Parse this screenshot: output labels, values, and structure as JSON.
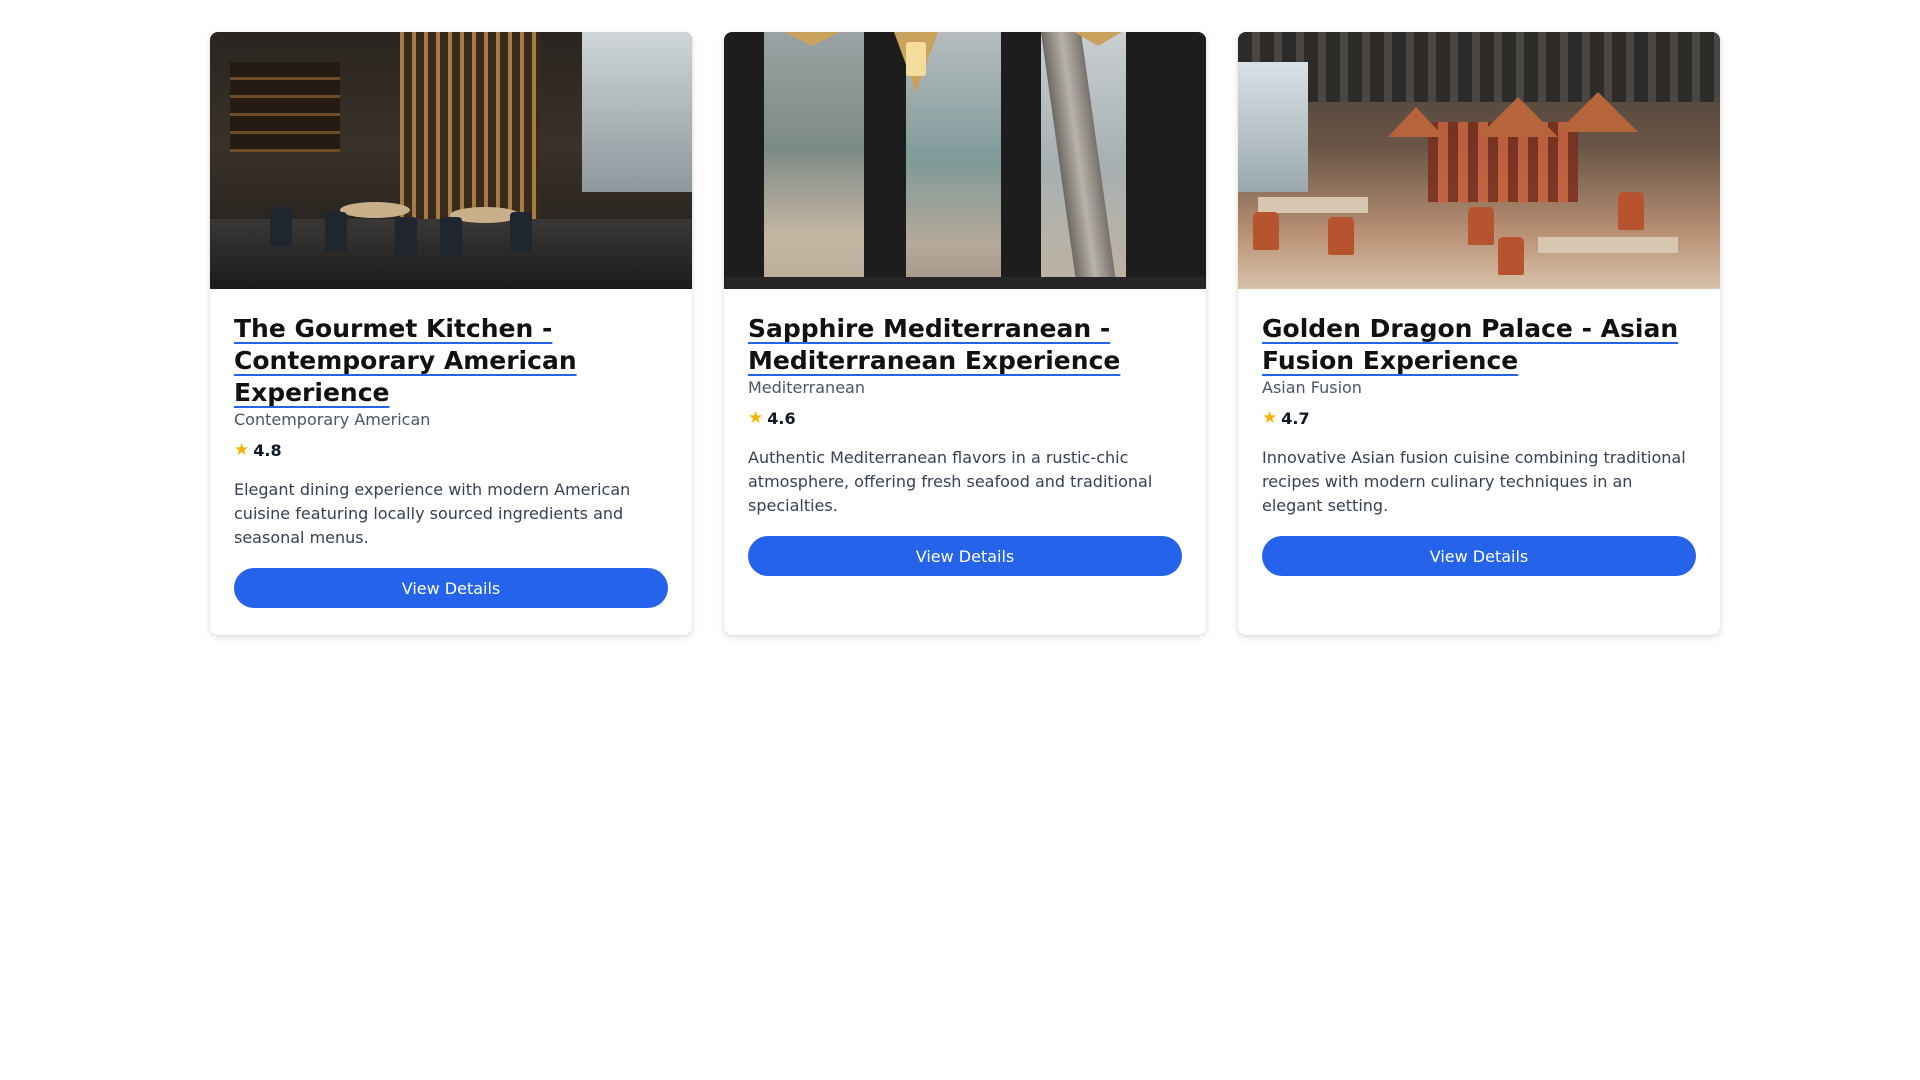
{
  "restaurants": [
    {
      "title": "The Gourmet Kitchen - Contemporary American Experience",
      "cuisine": "Contemporary American",
      "rating": "4.8",
      "description": "Elegant dining experience with modern American cuisine featuring locally sourced ingredients and seasonal menus.",
      "button": "View Details"
    },
    {
      "title": "Sapphire Mediterranean - Mediterranean Experience",
      "cuisine": "Mediterranean",
      "rating": "4.6",
      "description": "Authentic Mediterranean flavors in a rustic-chic atmosphere, offering fresh seafood and traditional specialties.",
      "button": "View Details"
    },
    {
      "title": "Golden Dragon Palace - Asian Fusion Experience",
      "cuisine": "Asian Fusion",
      "rating": "4.7",
      "description": "Innovative Asian fusion cuisine combining traditional recipes with modern culinary techniques in an elegant setting.",
      "button": "View Details"
    }
  ],
  "icons": {
    "rating": "star-icon"
  },
  "colors": {
    "accent": "#2563eb",
    "star": "#f5b301"
  }
}
